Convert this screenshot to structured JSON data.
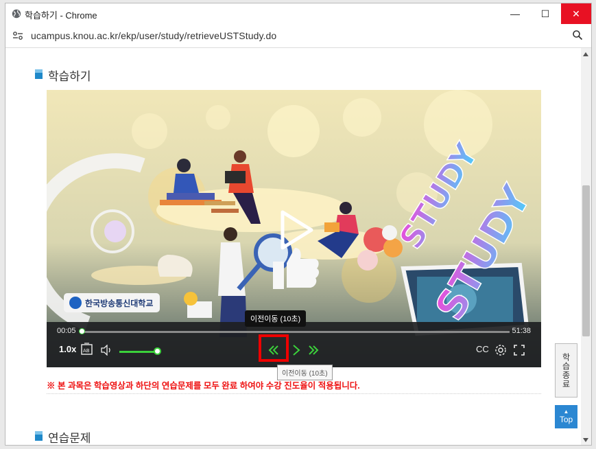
{
  "window": {
    "title": "학습하기 - Chrome",
    "url": "ucampus.knou.ac.kr/ekp/user/study/retrieveUSTStudy.do",
    "minimize_label": "—",
    "maximize_label": "☐",
    "close_label": "✕"
  },
  "page": {
    "section1_title": "학습하기",
    "section2_title": "연습문제",
    "notice": "※ 본 과목은 학습영상과 하단의 연습문제를 모두 완료 하여야 수강 진도율이 적용됩니다.",
    "side_button_label": "학습종료",
    "top_button_label": "Top"
  },
  "video": {
    "logo_text": "한국방송통신대학교",
    "study_text": "STUDY",
    "current_time": "00:05",
    "total_time": "51:38",
    "progress": 0.0016,
    "volume": 0.9,
    "speed_label": "1.0x",
    "tooltip_dark": "이전이동 (10초)",
    "tooltip_light": "이전이동 (10초)",
    "cc_label": "CC"
  },
  "colors": {
    "accent_green": "#3bd23b",
    "close_red": "#e81123",
    "notice_red": "#ee1111",
    "top_blue": "#2b87d2",
    "highlight_red": "#ee0000"
  },
  "icons": [
    "globe-icon",
    "site-settings-icon",
    "zoom-icon",
    "play-icon",
    "thumbs-up-icon",
    "subtitle-ab-icon",
    "volume-icon",
    "rewind-10-icon",
    "play-small-icon",
    "forward-10-icon",
    "cc-icon",
    "settings-gear-icon",
    "fullscreen-icon"
  ]
}
